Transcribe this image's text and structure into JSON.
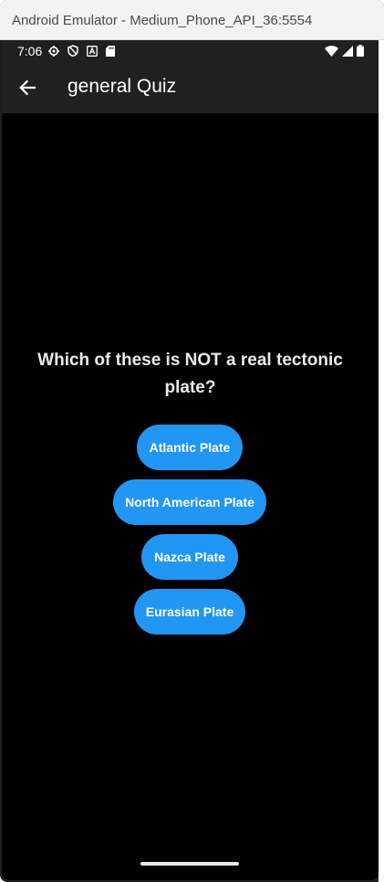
{
  "window": {
    "title": "Android Emulator - Medium_Phone_API_36:5554"
  },
  "status_bar": {
    "time": "7:06",
    "left_icons": [
      "settings-gear-icon",
      "shield-icon",
      "text-a-icon",
      "sd-card-icon"
    ],
    "right_icons": [
      "wifi-icon",
      "signal-icon",
      "battery-icon"
    ]
  },
  "app_bar": {
    "back_icon": "arrow-left-icon",
    "title": "general Quiz"
  },
  "quiz": {
    "question": "Which of these is NOT a real tectonic plate?",
    "answers": [
      "Atlantic Plate",
      "North American Plate",
      "Nazca Plate",
      "Eurasian Plate"
    ],
    "button_color": "#2196f3"
  }
}
